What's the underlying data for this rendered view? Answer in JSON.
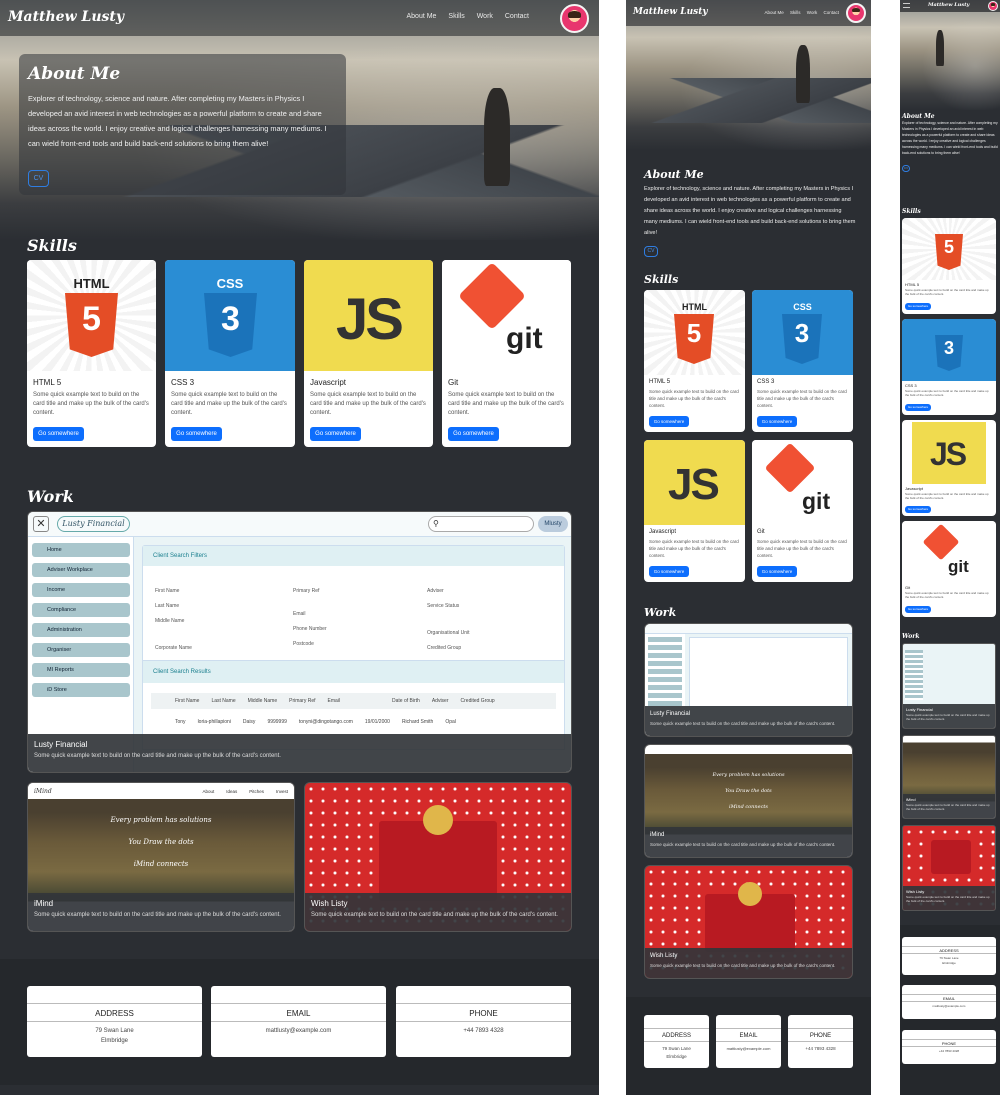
{
  "site": {
    "brand": "Matthew Lusty",
    "nav": [
      "About Me",
      "Skills",
      "Work",
      "Contact"
    ]
  },
  "about": {
    "title": "About Me",
    "text": "Explorer of technology, science and nature. After completing my Masters in Physics I developed an avid interest in web technologies as a powerful platform to create and share ideas across the world. I enjoy creative and logical challenges harnessing many mediums. I can wield front-end tools and build back-end solutions to bring them alive!",
    "cv_label": "CV"
  },
  "skills": {
    "title": "Skills",
    "cards": [
      {
        "title": "HTML 5",
        "text": "Some quick example text to build on the card title and make up the bulk of the card's content.",
        "button": "Go somewhere",
        "logo": "5",
        "logo_top": "HTML"
      },
      {
        "title": "CSS 3",
        "text": "Some quick example text to build on the card title and make up the bulk of the card's content.",
        "button": "Go somewhere",
        "logo": "3",
        "logo_top": "CSS"
      },
      {
        "title": "Javascript",
        "text": "Some quick example text to build on the card title and make up the bulk of the card's content.",
        "button": "Go somewhere",
        "logo": "JS"
      },
      {
        "title": "Git",
        "text": "Some quick example text to build on the card title and make up the bulk of the card's content.",
        "button": "Go somewhere",
        "logo": "git"
      }
    ]
  },
  "work": {
    "title": "Work",
    "cards": [
      {
        "title": "Lusty Financial",
        "text": "Some quick example text to build on the card title and make up the bulk of the card's content."
      },
      {
        "title": "iMind",
        "text": "Some quick example text to build on the card title and make up the bulk of the card's content."
      },
      {
        "title": "Wish Listy",
        "text": "Some quick example text to build on the card title and make up the bulk of the card's content."
      }
    ],
    "lusty_ui": {
      "logo": "Lusty Financial",
      "user": "Mlusty",
      "menu": [
        "Home",
        "Adviser Workplace",
        "Income",
        "Compliance",
        "Administration",
        "Organiser",
        "MI Reports",
        "iD Store"
      ],
      "filters_title": "Client Search Filters",
      "filter_fields": [
        "First Name",
        "Last Name",
        "Middle Name",
        "Corporate Name",
        "Primary Ref",
        "Email",
        "Phone Number",
        "Postcode",
        "Adviser",
        "Service Status",
        "Organisational Unit",
        "Credited Group"
      ],
      "results_title": "Client Search Results",
      "columns": [
        "First Name",
        "Last Name",
        "Middle Name",
        "Primary Ref",
        "Email",
        "Date of Birth",
        "Adviser",
        "Credited Group"
      ],
      "row": [
        "Tony",
        "loria-phillapioni",
        "Daisy",
        "9999999",
        "tonyni@dingotango.com",
        "19/01/2000",
        "Richard Smith",
        "Opal"
      ]
    },
    "imind_ui": {
      "logo": "iMind",
      "nav": [
        "About",
        "Ideas",
        "Pitches",
        "Invest"
      ],
      "lines": [
        "Every problem has solutions",
        "You Draw the dots",
        "iMind connects"
      ]
    }
  },
  "contact": {
    "cards": [
      {
        "title": "ADDRESS",
        "lines": [
          "79 Swan Lane",
          "Elmbridge"
        ]
      },
      {
        "title": "EMAIL",
        "lines": [
          "mattlusty@example.com"
        ]
      },
      {
        "title": "PHONE",
        "lines": [
          "+44 7893 4328"
        ]
      }
    ]
  },
  "colors": {
    "accent": "#0d6efd",
    "bg": "#2b2e33",
    "footer": "#25282c"
  }
}
